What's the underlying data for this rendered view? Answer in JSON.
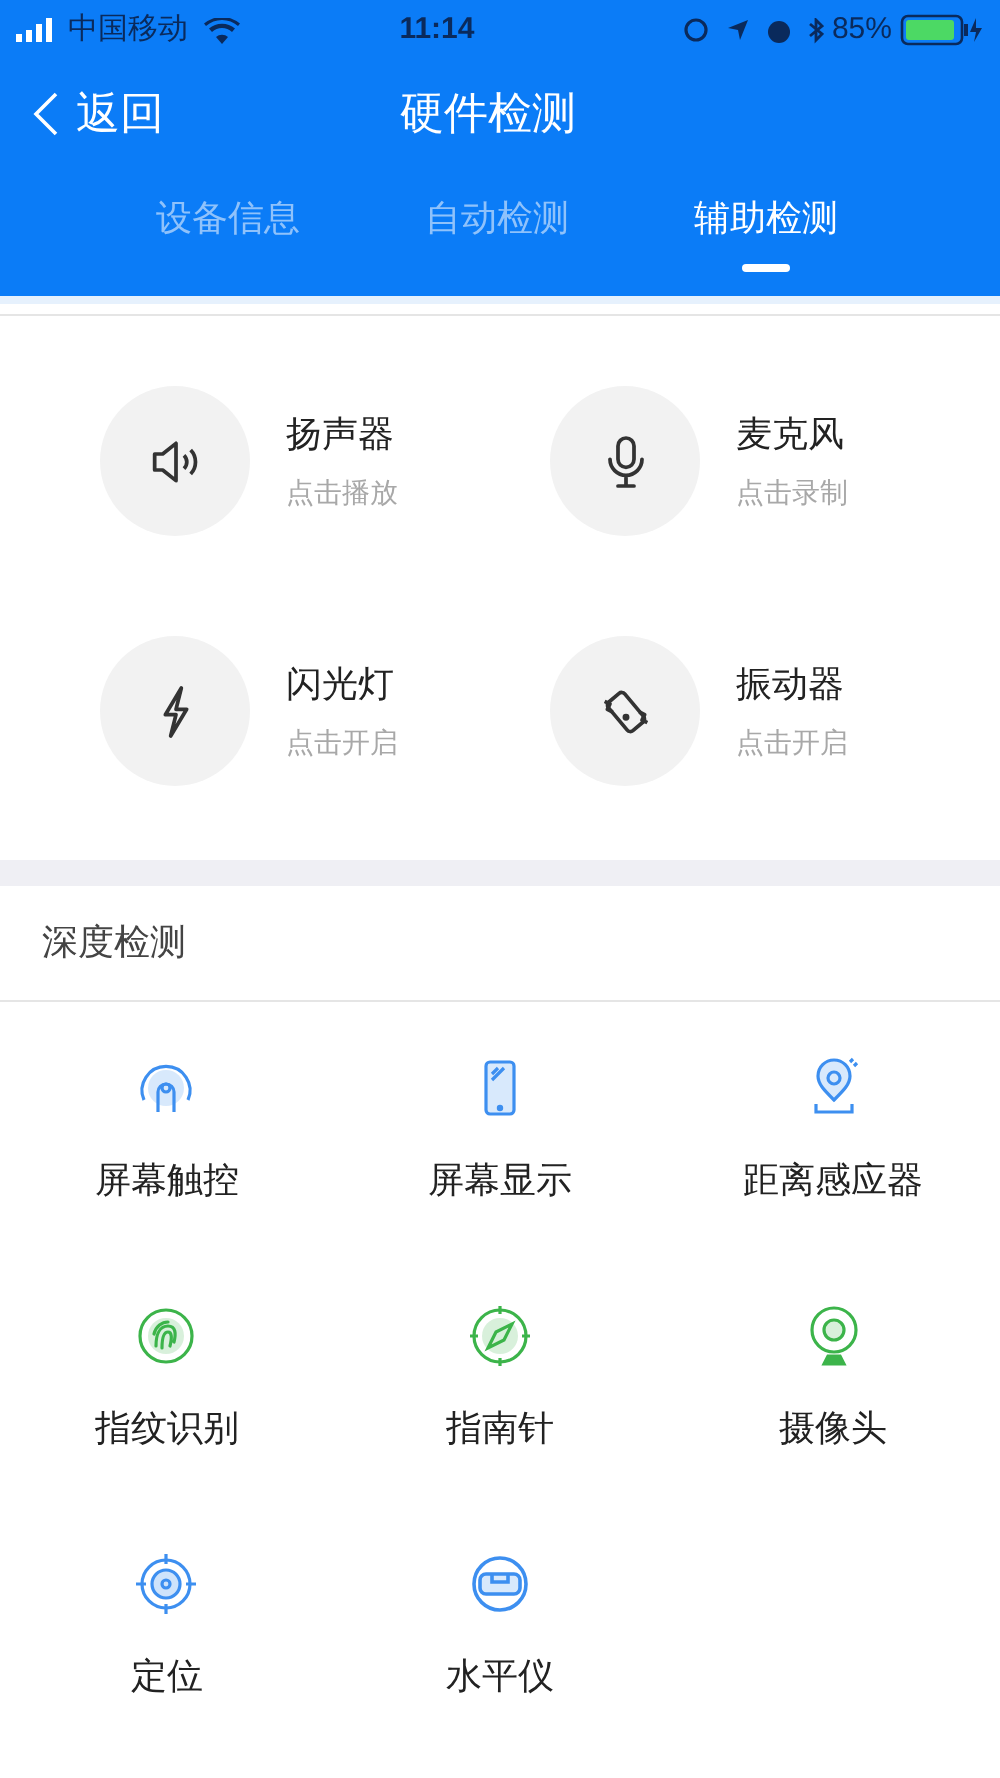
{
  "status_bar": {
    "carrier": "中国移动",
    "time": "11:14",
    "battery": "85%"
  },
  "nav": {
    "back": "返回",
    "title": "硬件检测"
  },
  "tabs": [
    {
      "label": "设备信息",
      "selected": false
    },
    {
      "label": "自动检测",
      "selected": false
    },
    {
      "label": "辅助检测",
      "selected": true
    }
  ],
  "quick_tests": [
    {
      "name": "扬声器",
      "action": "点击播放"
    },
    {
      "name": "麦克风",
      "action": "点击录制"
    },
    {
      "name": "闪光灯",
      "action": "点击开启"
    },
    {
      "name": "振动器",
      "action": "点击开启"
    }
  ],
  "deep_section": {
    "title": "深度检测",
    "items": [
      {
        "name": "屏幕触控",
        "color": "#3d8ff0"
      },
      {
        "name": "屏幕显示",
        "color": "#3d8ff0"
      },
      {
        "name": "距离感应器",
        "color": "#3d8ff0"
      },
      {
        "name": "指纹识别",
        "color": "#3cb44a"
      },
      {
        "name": "指南针",
        "color": "#3cb44a"
      },
      {
        "name": "摄像头",
        "color": "#3cb44a"
      },
      {
        "name": "定位",
        "color": "#3d8ff0"
      },
      {
        "name": "水平仪",
        "color": "#3d8ff0"
      }
    ]
  }
}
